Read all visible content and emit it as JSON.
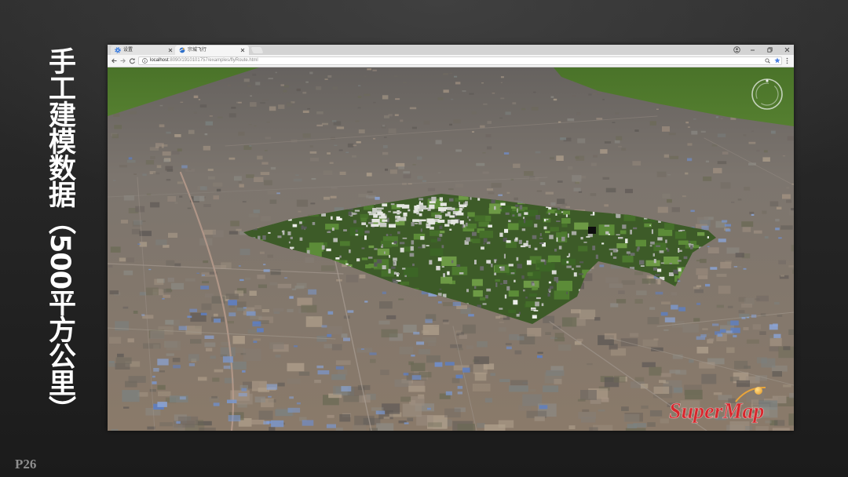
{
  "slide": {
    "title": "手工建模数据（500平方公里）",
    "page_number": "P26",
    "colors": {
      "title": "#ffffff",
      "page_number": "#8e8e8e",
      "background": "#232323"
    }
  },
  "browser": {
    "tabs": [
      {
        "label": "设置",
        "icon": "gear-icon",
        "active": false
      },
      {
        "label": "宗城飞行",
        "icon": "supermap-favicon-icon",
        "active": true
      }
    ],
    "window_controls": [
      "account-icon",
      "minimize-icon",
      "restore-icon",
      "close-window-icon"
    ],
    "toolbar": {
      "nav_icons": [
        "back-arrow-icon",
        "forward-arrow-icon",
        "reload-icon"
      ],
      "url_host": "localhost",
      "url_path": ":8090/1910101757/examples/flyRoute.html",
      "omnibox_icons": [
        "info-icon",
        "zoom-icon",
        "bookmark-star-icon"
      ],
      "menu_icon": "menu-icon"
    }
  },
  "map": {
    "logo_text": "SuperMap",
    "widgets": [
      "compass-icon"
    ],
    "colors": {
      "terrain": "#857a70",
      "vegetation": "#4f7a2c",
      "city_model": "#3d5b28",
      "logo": "#d7262c",
      "logo_accent": "#e8a43a",
      "star": "#4a7fe0"
    }
  }
}
